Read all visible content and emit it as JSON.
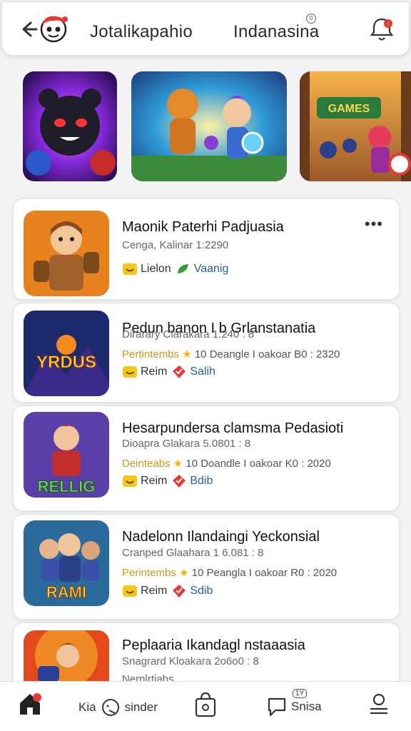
{
  "header": {
    "tabs": [
      {
        "label": "Jotalikapahio"
      },
      {
        "label": "Indanasina"
      }
    ],
    "tab_badge": "0"
  },
  "banners": [
    {
      "title": ""
    },
    {
      "title": ""
    },
    {
      "title": "GAMES"
    }
  ],
  "games": [
    {
      "title": "Maonik Paterhi Padjuasia",
      "meta": "Cenga, Kalinar  1:2290",
      "meta_extra": "",
      "tag1": "Lielon",
      "tag2": "Vaanig",
      "thumb_text": ""
    },
    {
      "title": "Pedun banon I b Grlanstanatia",
      "meta": "Dirarary Clarakara 1.240 : 8",
      "meta_extra_gold": "Pertintembs",
      "meta_extra_rest": " 10  Deangle I oakoar  B0 : 2320",
      "tag1": "Reim",
      "tag2": "Salih",
      "thumb_text": "YRDUS"
    },
    {
      "title": "Hesarpundersa clamsma Pedasioti",
      "meta": "Dioapra Glakara 5.0801 : 8",
      "meta_extra_gold": "Deinteabs",
      "meta_extra_rest": " 10  Doandle I oakoar  K0 : 2020",
      "tag1": "Reim",
      "tag2": "Bdib",
      "thumb_text": "RELLIG"
    },
    {
      "title": "Nadelonn Ilandaingi Yeckonsial",
      "meta": "Cranped Glaahara 1 6.081 : 8",
      "meta_extra_gold": "Perintembs",
      "meta_extra_rest": " 10  Peangla I oakoar  R0 : 2020",
      "tag1": "Reim",
      "tag2": "Sdib",
      "thumb_text": "RAMI"
    },
    {
      "title": "Peplaaria Ikandagl nstaaasia",
      "meta": "Snagrard Kloakara 2o6o0 : 8",
      "meta_extra_gold": "",
      "meta_extra_rest": "Nernlrtiabs",
      "tag1": "",
      "tag2": "",
      "thumb_text": ""
    }
  ],
  "bottom_nav": {
    "item2_prefix": "Kia",
    "item2_label": "sinder",
    "item4_label": "Snisa",
    "item4_badge": "1Y"
  },
  "colors": {
    "accent_red": "#e53935",
    "gold": "#c99a16",
    "blue_link": "#2a5f8f"
  }
}
